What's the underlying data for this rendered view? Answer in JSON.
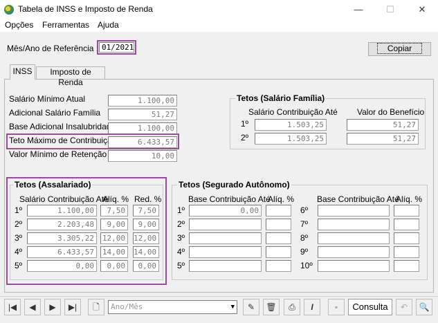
{
  "window": {
    "title": "Tabela de INSS e Imposto de Renda",
    "min": "—",
    "max": "☐",
    "close": "✕"
  },
  "menu": [
    "Opções",
    "Ferramentas",
    "Ajuda"
  ],
  "ref": {
    "label": "Mês/Ano de Referência :",
    "value": "01/2021"
  },
  "copy_button": "Copiar",
  "tabs": [
    "INSS",
    "Imposto de Renda"
  ],
  "inss": {
    "fields": [
      {
        "label": "Salário Mínimo Atual",
        "value": "1.100,00"
      },
      {
        "label": "Adicional Salário Família",
        "value": "51,27"
      },
      {
        "label": "Base Adicional Insalubridade",
        "value": "1.100,00"
      },
      {
        "label": "Teto Máximo de Contribuição",
        "value": "6.433,57"
      },
      {
        "label": "Valor Mínimo de Retenção",
        "value": "10,00"
      }
    ],
    "familia": {
      "title": "Tetos (Salário Família)",
      "col1": "Salário Contribuição Até",
      "col2": "Valor do Benefício",
      "rows": [
        {
          "n": "1º",
          "base": "1.503,25",
          "valor": "51,27"
        },
        {
          "n": "2º",
          "base": "1.503,25",
          "valor": "51,27"
        }
      ]
    },
    "assalariado": {
      "title": "Tetos (Assalariado)",
      "col1": "Salário Contribuição Até",
      "col2": "Alíq. %",
      "col3": "Red. %",
      "rows": [
        {
          "n": "1º",
          "base": "1.100,00",
          "aliq": "7,50",
          "red": "7,50"
        },
        {
          "n": "2º",
          "base": "2.203,48",
          "aliq": "9,00",
          "red": "9,00"
        },
        {
          "n": "3º",
          "base": "3.305,22",
          "aliq": "12,00",
          "red": "12,00"
        },
        {
          "n": "4º",
          "base": "6.433,57",
          "aliq": "14,00",
          "red": "14,00"
        },
        {
          "n": "5º",
          "base": "0,00",
          "aliq": "0,00",
          "red": "0,00"
        }
      ]
    },
    "autonomo": {
      "title": "Tetos (Segurado Autônomo)",
      "col1": "Base Contribuição Até",
      "col2": "Alíq. %",
      "left": [
        {
          "n": "1º",
          "base": "0,00",
          "aliq": ""
        },
        {
          "n": "2º",
          "base": "",
          "aliq": ""
        },
        {
          "n": "3º",
          "base": "",
          "aliq": ""
        },
        {
          "n": "4º",
          "base": "",
          "aliq": ""
        },
        {
          "n": "5º",
          "base": "",
          "aliq": ""
        }
      ],
      "right": [
        {
          "n": "6º",
          "base": "",
          "aliq": ""
        },
        {
          "n": "7º",
          "base": "",
          "aliq": ""
        },
        {
          "n": "8º",
          "base": "",
          "aliq": ""
        },
        {
          "n": "9º",
          "base": "",
          "aliq": ""
        },
        {
          "n": "10º",
          "base": "",
          "aliq": ""
        }
      ]
    }
  },
  "toolbar": {
    "combo_placeholder": "Ano/Mês",
    "mode": "Consulta"
  }
}
